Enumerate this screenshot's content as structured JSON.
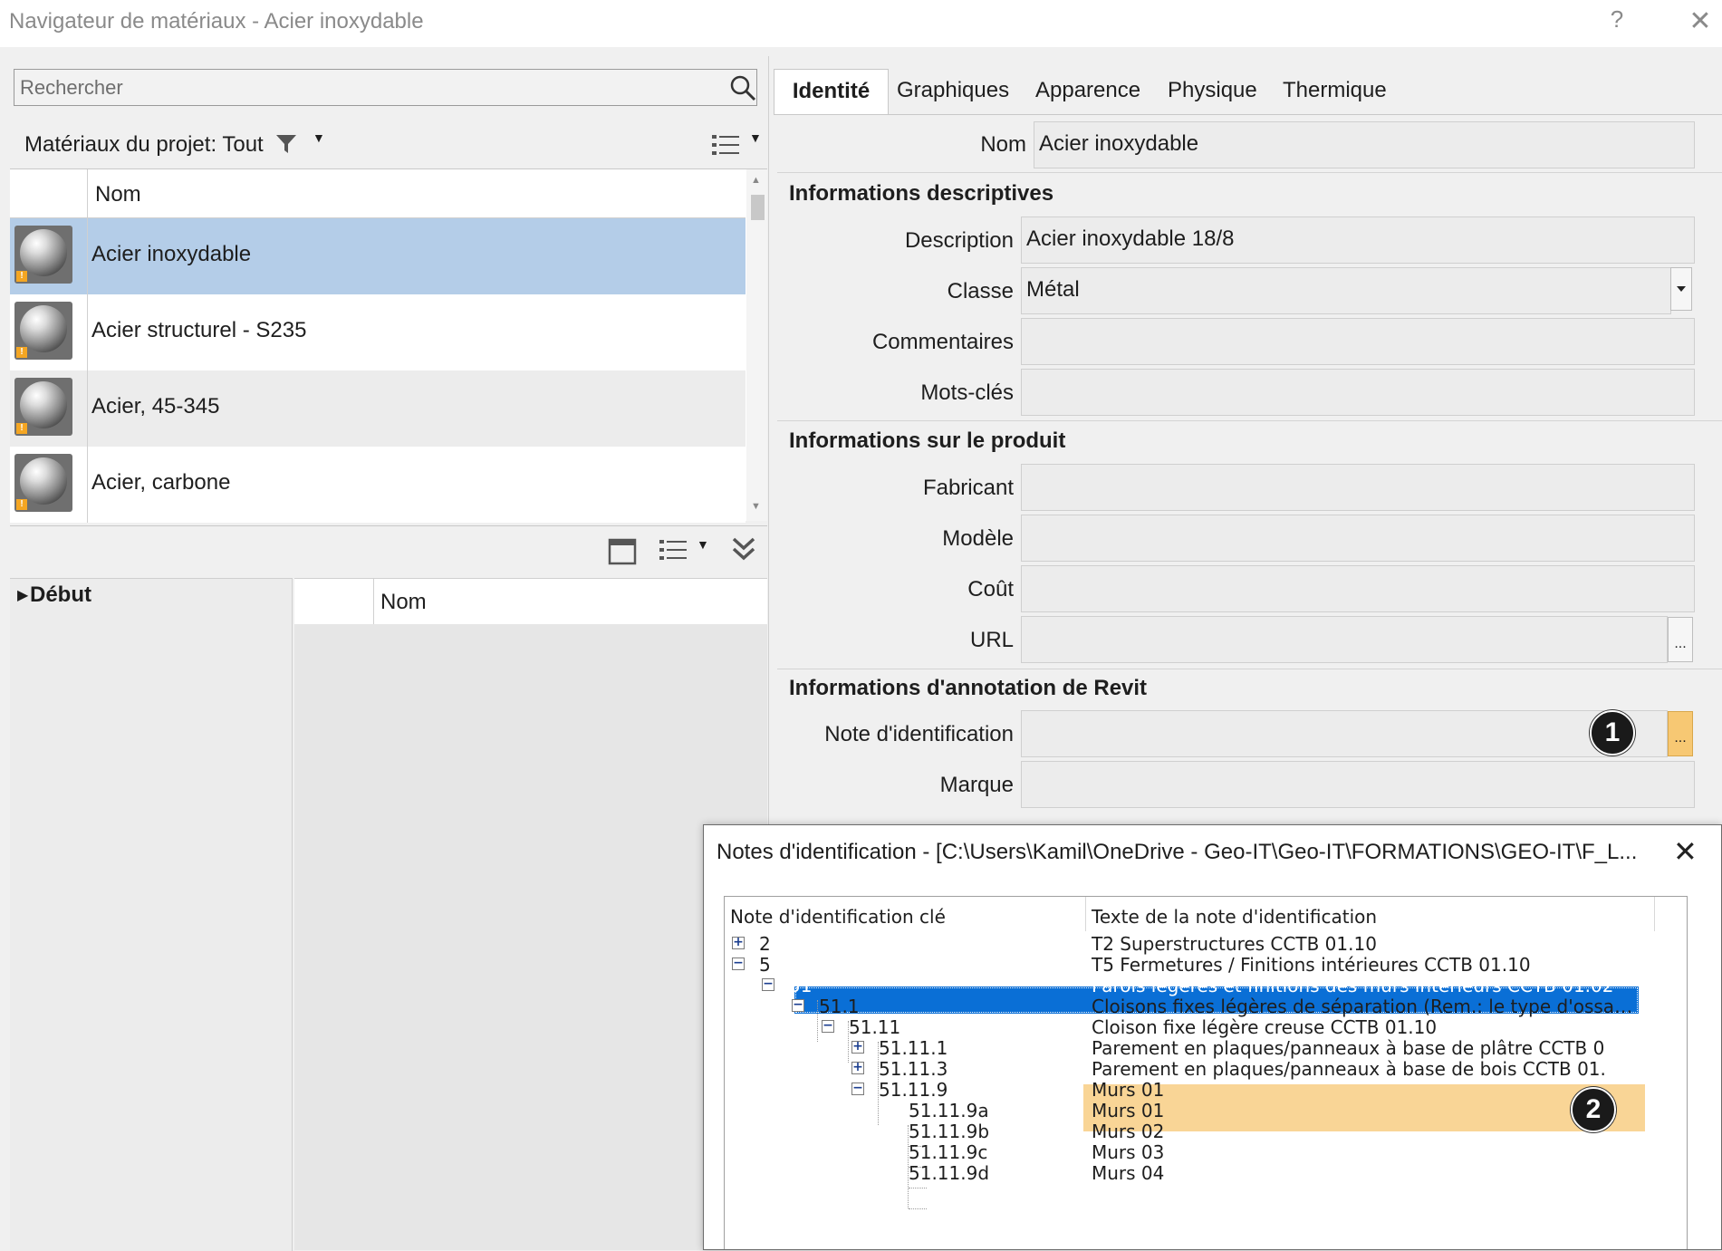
{
  "window": {
    "title": "Navigateur de matériaux - Acier inoxydable",
    "help_label": "?",
    "close_label": "✕"
  },
  "search": {
    "placeholder": "Rechercher"
  },
  "project": {
    "label": "Matériaux du projet: Tout"
  },
  "materials": {
    "column_name": "Nom",
    "items": [
      {
        "name": "Acier inoxydable",
        "selected": true
      },
      {
        "name": "Acier structurel - S235"
      },
      {
        "name": "Acier, 45-345"
      },
      {
        "name": "Acier, carbone"
      }
    ]
  },
  "library": {
    "tree_root": "Début",
    "column_name": "Nom"
  },
  "tabs": [
    "Identité",
    "Graphiques",
    "Apparence",
    "Physique",
    "Thermique"
  ],
  "identity": {
    "name_label": "Nom",
    "name_value": "Acier inoxydable",
    "descriptive_title": "Informations descriptives",
    "description_label": "Description",
    "description_value": "Acier inoxydable 18/8",
    "classe_label": "Classe",
    "classe_value": "Métal",
    "commentaires_label": "Commentaires",
    "motscles_label": "Mots-clés",
    "product_title": "Informations sur le produit",
    "fabricant_label": "Fabricant",
    "modele_label": "Modèle",
    "cout_label": "Coût",
    "url_label": "URL",
    "revit_title": "Informations d'annotation de Revit",
    "note_label": "Note d'identification",
    "marque_label": "Marque",
    "ellipsis": "...",
    "callout_1": "1",
    "callout_2": "2"
  },
  "keynotes": {
    "title": "Notes d'identification - [C:\\Users\\Kamil\\OneDrive - Geo-IT\\Geo-IT\\FORMATIONS\\GEO-IT\\F_L...",
    "col_key": "Note d'identification clé",
    "col_text": "Texte de la note d'identification",
    "rows": [
      {
        "key": "2",
        "text": "T2 Superstructures CCTB 01.10"
      },
      {
        "key": "5",
        "text": "T5 Fermetures / Finitions intérieures CCTB 01.10"
      },
      {
        "key": "51",
        "text": "Parois légères et finitions des murs intérieurs CCTB 01.02"
      },
      {
        "key": "51.1",
        "text": "Cloisons fixes légères de séparation (Rem.: le type d'ossatu..."
      },
      {
        "key": "51.11",
        "text": "Cloison fixe légère creuse CCTB 01.10"
      },
      {
        "key": "51.11.1",
        "text": "Parement en plaques/panneaux à base de plâtre CCTB 0"
      },
      {
        "key": "51.11.3",
        "text": "Parement en plaques/panneaux à base de bois CCTB 01."
      },
      {
        "key": "51.11.9",
        "text": "Murs 01"
      },
      {
        "key": "51.11.9a",
        "text": "Murs 01"
      },
      {
        "key": "51.11.9b",
        "text": "Murs 02"
      },
      {
        "key": "51.11.9c",
        "text": "Murs 03"
      },
      {
        "key": "51.11.9d",
        "text": "Murs 04"
      }
    ]
  },
  "colors": {
    "selection_row": "#b4cde8",
    "tree_selection": "#0a6fd6",
    "highlight": "#f9d596",
    "callout_button": "#f7c873"
  }
}
